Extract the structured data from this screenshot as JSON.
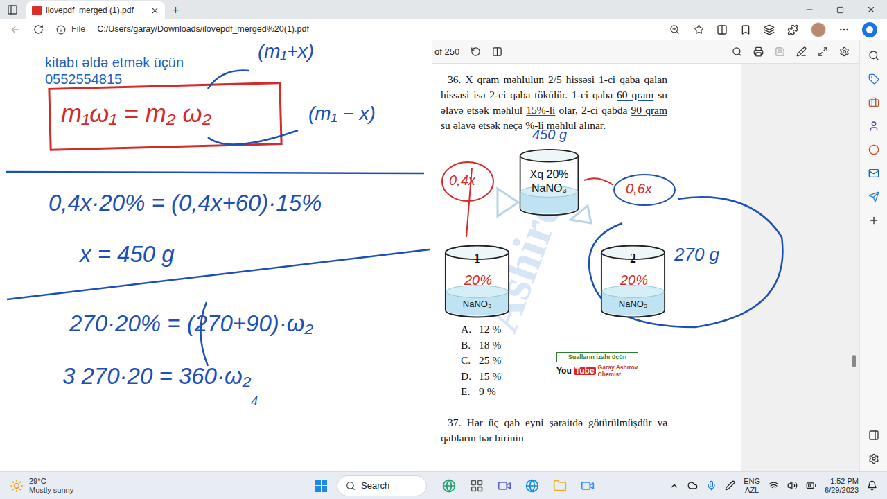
{
  "browser": {
    "tabs": [
      {
        "label": "ilovepdf_merged (1).pdf",
        "selected": true
      }
    ],
    "new_tab": "+",
    "address": {
      "scheme": "File",
      "url": "C:/Users/garay/Downloads/ilovepdf_merged%20(1).pdf"
    }
  },
  "viewer": {
    "page_count": "of 250"
  },
  "whiteboard": {
    "contact": [
      "kitabı əldə etmək üçün",
      "0552554815"
    ],
    "formula": "m₁ω₁ = m₂ ω₂",
    "formula_notes": [
      "(m₁+x)",
      "(m₁ − x)"
    ],
    "steps": [
      "0,4x·20% = (0,4x+60)·15%",
      "x = 450 g",
      "270·20% = (270+90)·ω₂",
      "3 270·20 = 360·ω₂",
      "4"
    ]
  },
  "page": {
    "watermark": "Ashirov",
    "question_36": {
      "number": "36.",
      "segments": [
        {
          "text": "X qram məhlulun 2/5 hissəsi 1-ci qaba qalan hissəsi isə 2-ci qaba tökülür.  1-ci qaba ",
          "underlined": false
        },
        {
          "text": "60 qram",
          "underlined": true
        },
        {
          "text": " su əlavə etsək məhlul ",
          "underlined": false
        },
        {
          "text": "15%-li",
          "underlined": true
        },
        {
          "text": " olar, 2-ci qabda ",
          "underlined": false
        },
        {
          "text": "90 qram",
          "underlined": true
        },
        {
          "text": " su əlavə etsək neçə %-li məhlul alınar.",
          "underlined": false
        }
      ]
    },
    "diagram": {
      "top_beaker": {
        "mass": "Xq 20%",
        "substance": "NaNO₃",
        "note": "450 g"
      },
      "left_note": "0,4x",
      "right_note": "0,6x",
      "beakers": [
        {
          "number": "1",
          "percent": "20%",
          "substance": "NaNO₃",
          "note": ""
        },
        {
          "number": "2",
          "percent": "20%",
          "substance": "NaNO₃",
          "note": "270 g"
        }
      ]
    },
    "options": [
      {
        "letter": "A.",
        "value": "12 %"
      },
      {
        "letter": "B.",
        "value": "18 %"
      },
      {
        "letter": "C.",
        "value": "25 %"
      },
      {
        "letter": "D.",
        "value": "15 %"
      },
      {
        "letter": "E.",
        "value": "9 %"
      }
    ],
    "badge": {
      "caption": "Sualların izahı üçün",
      "logo": [
        "You",
        "Tube"
      ],
      "author": "Garay Ashirov",
      "role": "Chemist"
    },
    "question_37": {
      "number": "37.",
      "text": "Hər üç qab eyni şəraitdə götürülmüşdür və qabların hər birinin"
    }
  },
  "taskbar": {
    "weather": {
      "temp": "29°C",
      "summary": "Mostly sunny"
    },
    "search": "Search",
    "lang": [
      "ENG",
      "AZL"
    ],
    "time": "1:52 PM",
    "date": "6/29/2023"
  }
}
